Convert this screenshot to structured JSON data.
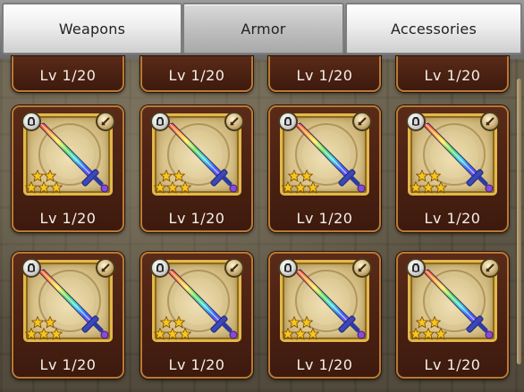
{
  "tabs": [
    {
      "label": "Weapons",
      "active": false
    },
    {
      "label": "Armor",
      "active": true
    },
    {
      "label": "Accessories",
      "active": false
    }
  ],
  "grid": {
    "top_row_cut": [
      {
        "level": "Lv 1/20"
      },
      {
        "level": "Lv 1/20"
      },
      {
        "level": "Lv 1/20"
      },
      {
        "level": "Lv 1/20"
      }
    ],
    "rows": [
      [
        {
          "level": "Lv 1/20",
          "stars": 5,
          "item_icon": "rainbow-sword-icon",
          "type_icon": "sword-type-icon",
          "slot_icon": "gem-slot-icon"
        },
        {
          "level": "Lv 1/20",
          "stars": 5,
          "item_icon": "rainbow-sword-icon",
          "type_icon": "sword-type-icon",
          "slot_icon": "gem-slot-icon"
        },
        {
          "level": "Lv 1/20",
          "stars": 5,
          "item_icon": "rainbow-sword-icon",
          "type_icon": "sword-type-icon",
          "slot_icon": "gem-slot-icon"
        },
        {
          "level": "Lv 1/20",
          "stars": 5,
          "item_icon": "rainbow-sword-icon",
          "type_icon": "sword-type-icon",
          "slot_icon": "gem-slot-icon"
        }
      ],
      [
        {
          "level": "Lv 1/20",
          "stars": 5,
          "item_icon": "rainbow-sword-icon",
          "type_icon": "sword-type-icon",
          "slot_icon": "gem-slot-icon"
        },
        {
          "level": "Lv 1/20",
          "stars": 5,
          "item_icon": "rainbow-sword-icon",
          "type_icon": "sword-type-icon",
          "slot_icon": "gem-slot-icon"
        },
        {
          "level": "Lv 1/20",
          "stars": 5,
          "item_icon": "rainbow-sword-icon",
          "type_icon": "sword-type-icon",
          "slot_icon": "gem-slot-icon"
        },
        {
          "level": "Lv 1/20",
          "stars": 5,
          "item_icon": "rainbow-sword-icon",
          "type_icon": "sword-type-icon",
          "slot_icon": "gem-slot-icon"
        }
      ]
    ]
  },
  "colors": {
    "card_border": "#b87a35",
    "card_fill": "#4a2214",
    "star": "#f5c21b"
  }
}
